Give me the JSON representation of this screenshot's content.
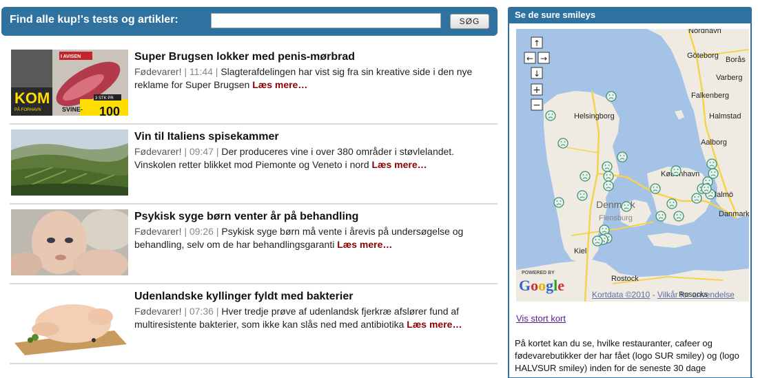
{
  "search": {
    "label": "Find alle kup!'s tests og artikler:",
    "value": "",
    "placeholder": "",
    "button": "SØG"
  },
  "articles": [
    {
      "title": "Super Brugsen lokker med penis-mørbrad",
      "category": "Fødevarer!",
      "time": "11:44",
      "text": "Slagterafdelingen har vist sig fra sin kreative side i den nye reklame for Super Brugsen",
      "more": "Læs mere…",
      "thumb_text_top": "I AVISEN",
      "thumb_text_big": "KOM",
      "thumb_text_sub": "PÅ FORHAVN",
      "thumb_text_bottom": "SVINE-",
      "thumb_text_price": "100",
      "thumb_text_price_tag": "3 STK PR"
    },
    {
      "title": "Vin til Italiens spisekammer",
      "category": "Fødevarer!",
      "time": "09:47",
      "text": "Der produceres vine i over 380 områder i støvlelandet. Vinskolen retter blikket mod Piemonte og Veneto i nord",
      "more": "Læs mere…"
    },
    {
      "title": "Psykisk syge børn venter år på behandling",
      "category": "Fødevarer!",
      "time": "09:26",
      "text": "Psykisk syge børn må vente i årevis på undersøgelse og behandling, selv om de har behandlingsgaranti",
      "more": "Læs mere…"
    },
    {
      "title": "Udenlandske kyllinger fyldt med bakterier",
      "category": "Fødevarer!",
      "time": "07:36",
      "text": "Hver tredje prøve af udenlandsk fjerkræ afslører fund af multiresistente bakterier, som ikke kan slås ned med antibiotika",
      "more": "Læs mere…"
    }
  ],
  "sidebar": {
    "title": "Se de sure smileys",
    "map_link": "Vis stort kort",
    "description": "På kortet kan du se, hvilke restauranter, cafeer og fødevarebutikker der har fået (logo SUR smiley) og (logo HALVSUR smiley) inden for de seneste 30 dage"
  },
  "map": {
    "powered_by": "POWERED BY",
    "google_letters": [
      "G",
      "o",
      "o",
      "g",
      "l",
      "e"
    ],
    "google_colors": [
      "#3366cc",
      "#cc3333",
      "#e8b000",
      "#3366cc",
      "#339933",
      "#cc3333"
    ],
    "copyright": "Kortdata ©2010",
    "dash": " - ",
    "terms": "Vilkår for anvendelse",
    "overlay_label": "Rosocks",
    "cities": [
      "Göteborg",
      "Borås",
      "Varberg",
      "Falkenberg",
      "Halmstad",
      "Aalborg",
      "Helsingborg",
      "København",
      "Malmö",
      "Danmark",
      "Denmark",
      "Flensburg",
      "Kiel",
      "Rostock",
      "Nordhavn"
    ],
    "controls": {
      "up": "↑",
      "left": "←",
      "right": "→",
      "down": "↓",
      "zoom_in": "+",
      "zoom_out": "−"
    },
    "land_color": "#efebe2",
    "water_color": "#a4c3e6",
    "road_color": "#f5d34a",
    "smiley_color": "#3f8f6f"
  }
}
